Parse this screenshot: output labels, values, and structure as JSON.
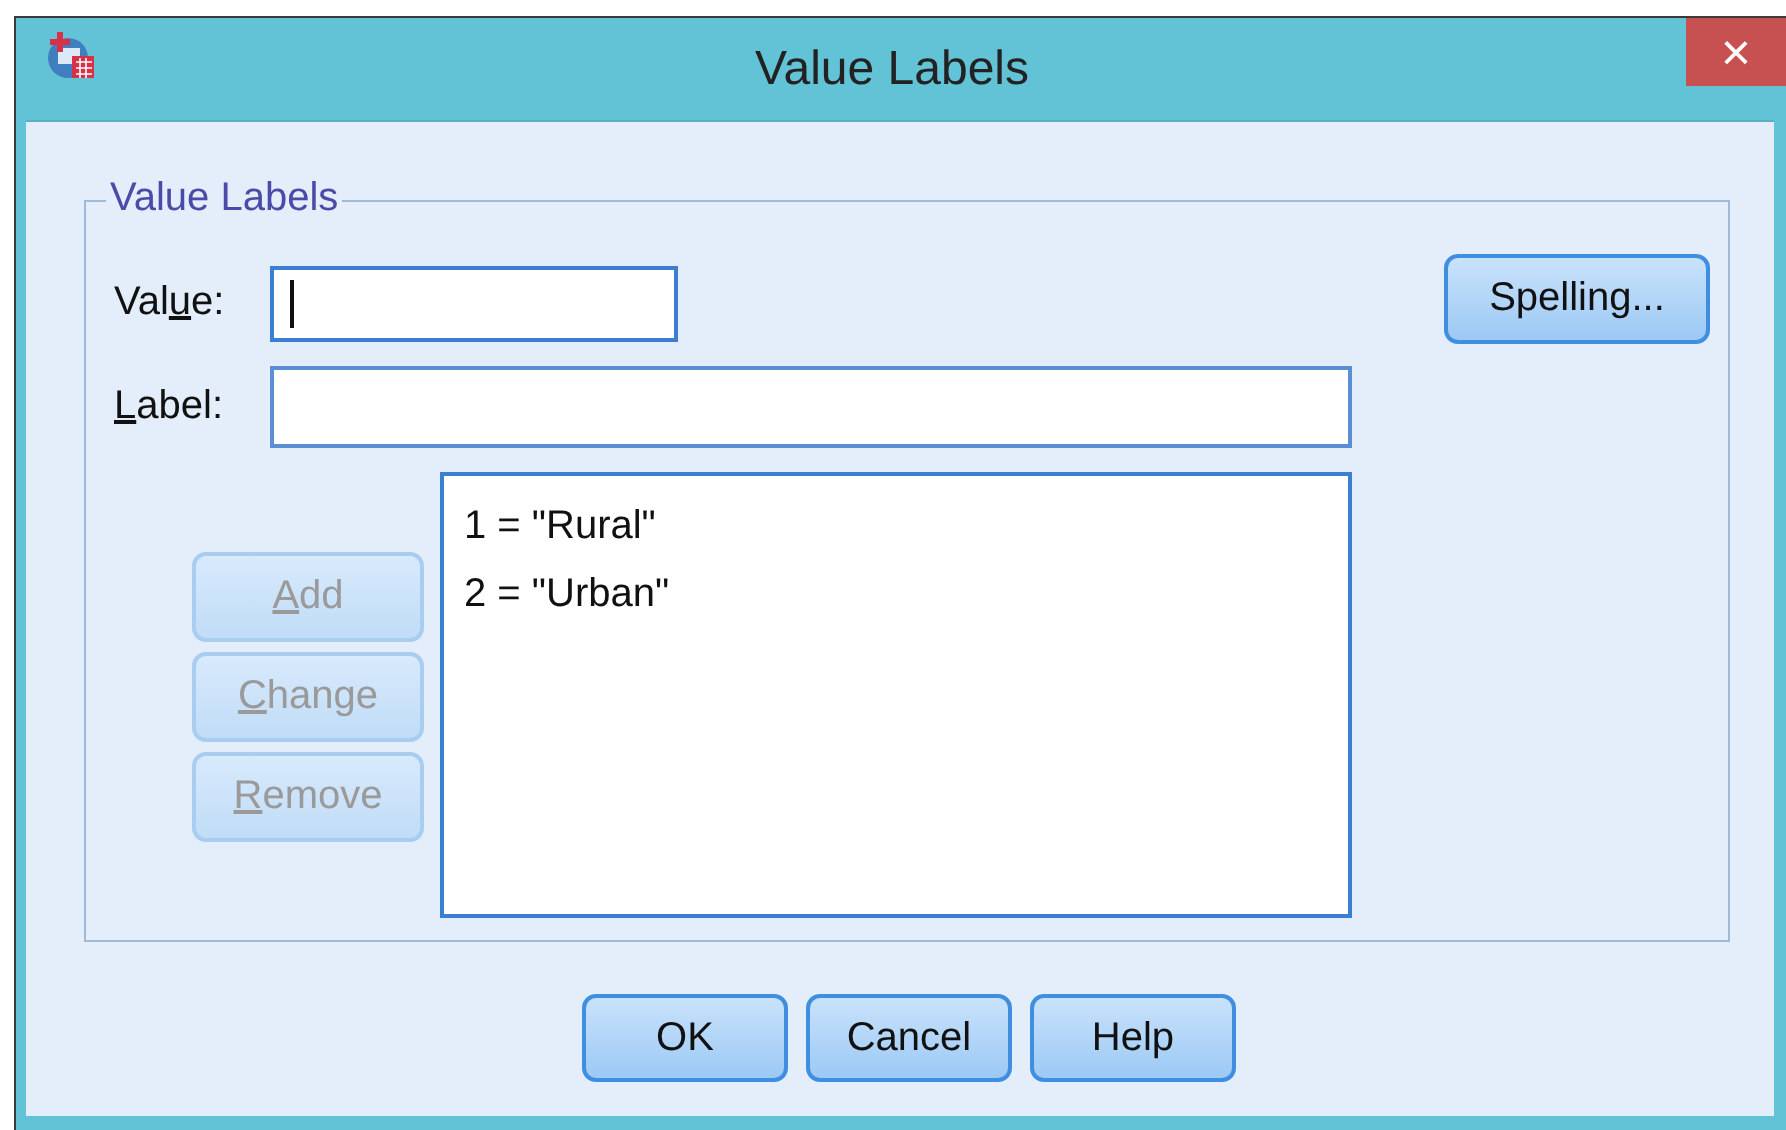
{
  "window": {
    "title": "Value Labels",
    "close": "×"
  },
  "group": {
    "title": "Value Labels"
  },
  "fields": [
    {
      "label": {
        "before": "Val",
        "access_key": "u",
        "after": "e:"
      },
      "focused": true
    },
    {
      "label": {
        "access_key": "L",
        "after": "abel:"
      },
      "focused": false
    }
  ],
  "spelling_button": "Spelling...",
  "side_buttons": [
    {
      "label": {
        "access_key": "A",
        "after": "dd"
      },
      "disabled": true
    },
    {
      "label": {
        "access_key": "C",
        "after": "hange"
      },
      "disabled": true
    },
    {
      "label": {
        "access_key": "R",
        "after": "emove"
      },
      "disabled": true
    }
  ],
  "labels_list": [
    "1 = \"Rural\"",
    "2 = \"Urban\""
  ],
  "buttons": [
    "OK",
    "Cancel",
    "Help"
  ]
}
